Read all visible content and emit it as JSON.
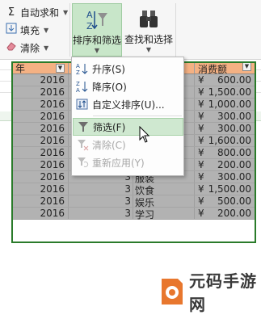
{
  "ribbon": {
    "autosum_label": "自动求和",
    "fill_label": "填充",
    "clear_label": "清除",
    "sort_filter_label": "排序和筛选",
    "find_select_label": "查找和选择"
  },
  "sort_menu": {
    "items": [
      {
        "label": "升序(S)",
        "icon": "sort-ascending-icon",
        "enabled": true
      },
      {
        "label": "降序(O)",
        "icon": "sort-descending-icon",
        "enabled": true
      },
      {
        "label": "自定义排序(U)...",
        "icon": "custom-sort-icon",
        "enabled": true
      },
      {
        "label": "筛选(F)",
        "icon": "filter-icon",
        "enabled": true,
        "highlighted": true
      },
      {
        "label": "清除(C)",
        "icon": "clear-filter-icon",
        "enabled": false
      },
      {
        "label": "重新应用(Y)",
        "icon": "reapply-icon",
        "enabled": false
      }
    ]
  },
  "table": {
    "headers": [
      "年",
      "",
      "",
      "消费额"
    ],
    "rows": [
      [
        "2016",
        "",
        "",
        "¥",
        "600.00"
      ],
      [
        "2016",
        "",
        "",
        "¥",
        "1,500.00"
      ],
      [
        "2016",
        "",
        "",
        "¥",
        "1,000.00"
      ],
      [
        "2016",
        "1",
        "学习",
        "¥",
        "300.00"
      ],
      [
        "2016",
        "1",
        "服装",
        "¥",
        "300.00"
      ],
      [
        "2016",
        "2",
        "饮食",
        "¥",
        "1,600.00"
      ],
      [
        "2016",
        "2",
        "娱乐",
        "¥",
        "800.00"
      ],
      [
        "2016",
        "2",
        "学习",
        "¥",
        "200.00"
      ],
      [
        "2016",
        "3",
        "服装",
        "¥",
        "300.00"
      ],
      [
        "2016",
        "3",
        "饮食",
        "¥",
        "1,500.00"
      ],
      [
        "2016",
        "3",
        "娱乐",
        "¥",
        "500.00"
      ],
      [
        "2016",
        "3",
        "学习",
        "¥",
        "200.00"
      ]
    ]
  },
  "watermark": {
    "text": "元码手游网"
  },
  "colors": {
    "header_fill": "#f4b183",
    "row_fill": "#b2b2b2",
    "selection_border": "#2a7b2a",
    "active_button": "#c8e6c9"
  }
}
